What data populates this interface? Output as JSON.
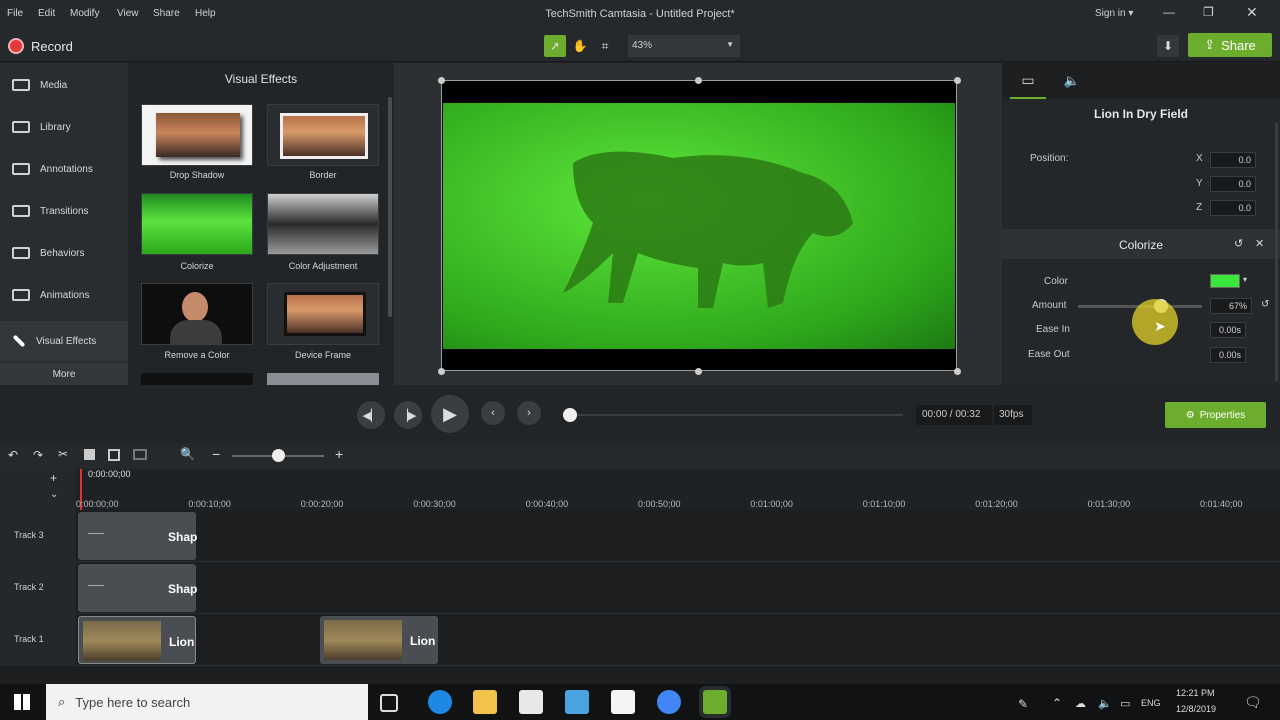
{
  "menu": [
    "File",
    "Edit",
    "Modify",
    "View",
    "Share",
    "Help"
  ],
  "window_title": "TechSmith Camtasia - Untitled Project*",
  "sign_in": "Sign in ▾",
  "toolbar": {
    "record_label": "Record",
    "zoom": "43%",
    "share_label": "Share"
  },
  "nav": [
    "Media",
    "Library",
    "Annotations",
    "Transitions",
    "Behaviors",
    "Animations",
    "Visual Effects"
  ],
  "nav_more": "More",
  "visual_effects": {
    "title": "Visual Effects",
    "items": [
      "Drop Shadow",
      "Border",
      "Colorize",
      "Color Adjustment",
      "Remove a Color",
      "Device Frame"
    ]
  },
  "properties": {
    "clip_name": "Lion In Dry Field",
    "position_label": "Position:",
    "x_label": "X",
    "x": "0.0",
    "y_label": "Y",
    "y": "0.0",
    "z_label": "Z",
    "z": "0.0",
    "effect_title": "Colorize",
    "color_label": "Color",
    "color_value": "#39e639",
    "amount_label": "Amount",
    "amount": "67%",
    "amount_fraction": 0.67,
    "ease_in_label": "Ease In",
    "ease_in": "0.00s",
    "ease_out_label": "Ease Out",
    "ease_out": "0.00s"
  },
  "playback": {
    "time": "00:00 / 00:32",
    "fps": "30fps",
    "properties_label": "Properties"
  },
  "timeline": {
    "playhead_time": "0:00:00;00",
    "ticks": [
      "0:00:00;00",
      "0:00:10;00",
      "0:00:20;00",
      "0:00:30;00",
      "0:00:40;00",
      "0:00:50;00",
      "0:01:00;00",
      "0:01:10;00",
      "0:01:20;00",
      "0:01:30;00",
      "0:01:40;00"
    ],
    "tracks": [
      {
        "name": "Track 3",
        "clips": [
          {
            "label": "Shap"
          }
        ]
      },
      {
        "name": "Track 2",
        "clips": [
          {
            "label": "Shap"
          }
        ]
      },
      {
        "name": "Track 1",
        "clips": [
          {
            "label": "Lion"
          },
          {
            "label": "Lion"
          }
        ]
      }
    ]
  },
  "taskbar": {
    "search_placeholder": "Type here to search",
    "lang": "ENG",
    "time": "12:21 PM",
    "date": "12/8/2019"
  },
  "colors": {
    "accent": "#6cad2e",
    "record": "#e03b3b",
    "colorize_tint": "#39e639"
  }
}
